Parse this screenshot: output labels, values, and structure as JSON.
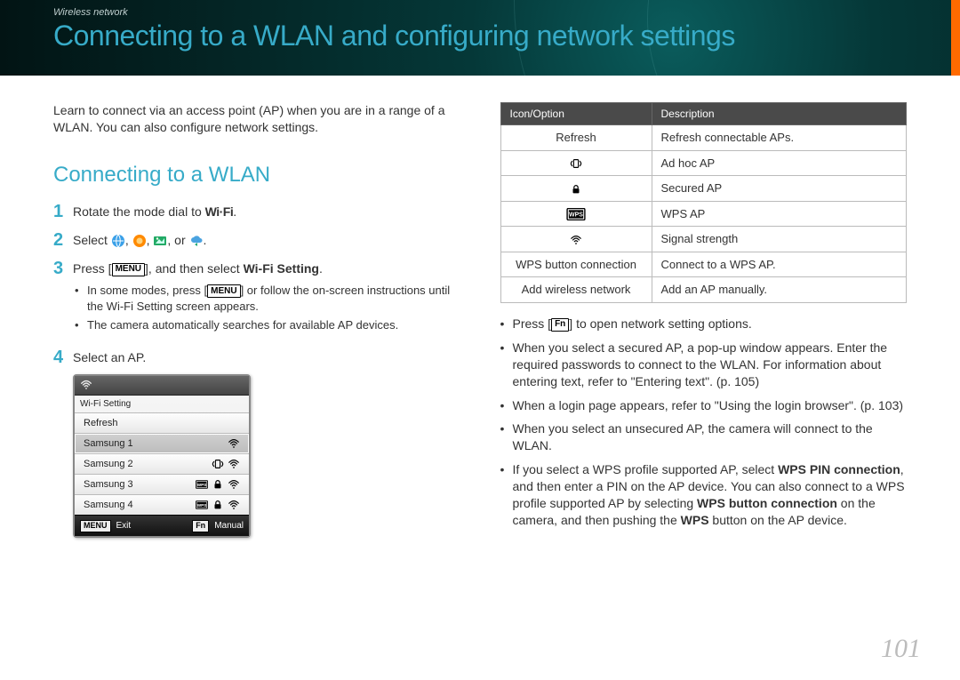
{
  "breadcrumb": "Wireless network",
  "page_title": "Connecting to a WLAN and configuring network settings",
  "intro": "Learn to connect via an access point (AP) when you are in a range of a WLAN. You can also configure network settings.",
  "section_title": "Connecting to a WLAN",
  "steps": {
    "s1_a": "Rotate the mode dial to ",
    "s1_b": ".",
    "wifi_label": "Wi·Fi",
    "s2_a": "Select ",
    "s2_or": ", or ",
    "s2_end": ".",
    "s3_a": "Press [",
    "s3_b": "], and then select ",
    "s3_c": "Wi-Fi Setting",
    "s3_d": ".",
    "s3_sub1a": "In some modes, press [",
    "s3_sub1b": "] or follow the on-screen instructions until the Wi-Fi Setting screen appears.",
    "s3_sub2": "The camera automatically searches for available AP devices.",
    "s4": "Select an AP."
  },
  "device": {
    "title": "Wi-Fi Setting",
    "rows": [
      "Refresh",
      "Samsung 1",
      "Samsung 2",
      "Samsung 3",
      "Samsung 4"
    ],
    "exit": "Exit",
    "manual": "Manual"
  },
  "table": {
    "h1": "Icon/Option",
    "h2": "Description",
    "rows": [
      {
        "opt": "Refresh",
        "desc": "Refresh connectable APs."
      },
      {
        "opt": "adhoc-icon",
        "desc": "Ad hoc AP"
      },
      {
        "opt": "lock-icon",
        "desc": "Secured AP"
      },
      {
        "opt": "wps-icon",
        "desc": "WPS AP"
      },
      {
        "opt": "signal-icon",
        "desc": "Signal strength"
      },
      {
        "opt": "WPS button connection",
        "desc": "Connect to a WPS AP."
      },
      {
        "opt": "Add wireless network",
        "desc": "Add an AP manually."
      }
    ]
  },
  "bullets": {
    "b1a": "Press [",
    "b1b": "] to open network setting options.",
    "b2": "When you select a secured AP, a pop-up window appears. Enter the required passwords to connect to the WLAN. For information about entering text, refer to \"Entering text\". (p. 105)",
    "b3": "When a login page appears, refer to \"Using the login browser\". (p. 103)",
    "b4": "When you select an unsecured AP, the camera will connect to the WLAN.",
    "b5a": "If you select a WPS profile supported AP, select ",
    "b5b": "WPS PIN connection",
    "b5c": ", and then enter a PIN on the AP device. You can also connect to a WPS profile supported AP by selecting ",
    "b5d": "WPS button connection",
    "b5e": " on the camera, and then pushing the ",
    "b5f": "WPS",
    "b5g": " button on the AP device."
  },
  "page_number": "101"
}
